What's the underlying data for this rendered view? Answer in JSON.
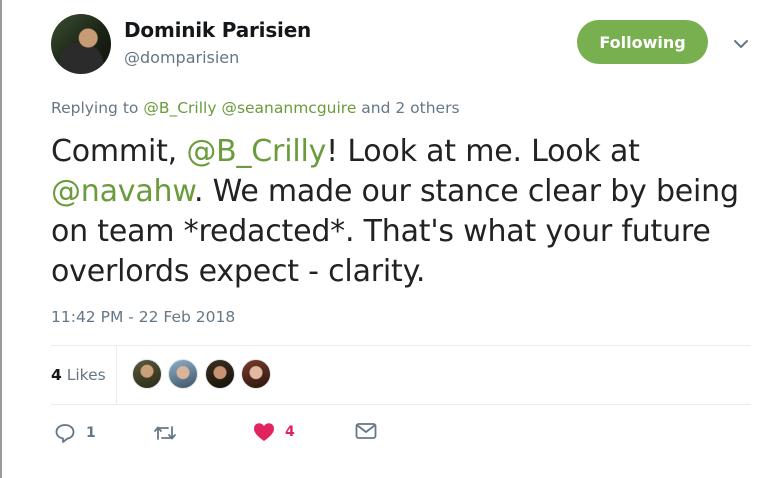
{
  "user": {
    "display_name": "Dominik Parisien",
    "handle": "@domparisien",
    "follow_label": "Following"
  },
  "tweet": {
    "reply_prefix": "Replying to",
    "reply_mentions": [
      "@B_Crilly",
      "@seananmcguire"
    ],
    "reply_suffix": "and 2 others",
    "text_parts": [
      {
        "t": "Commit, "
      },
      {
        "t": "@B_Crilly",
        "mention": true
      },
      {
        "t": "! Look at me. Look at "
      },
      {
        "t": "@navahw",
        "mention": true
      },
      {
        "t": ". We made our stance clear by being on team *redacted*. That's what your future overlords expect - clarity."
      }
    ],
    "timestamp": "11:42 PM - 22 Feb 2018"
  },
  "likes": {
    "count": "4",
    "label": "Likes"
  },
  "actions": {
    "reply_count": "1",
    "retweet_count": "",
    "like_count": "4"
  },
  "colors": {
    "accent": "#78b04f",
    "mention": "#6a9c3c",
    "like": "#e0245e",
    "muted": "#657786"
  }
}
